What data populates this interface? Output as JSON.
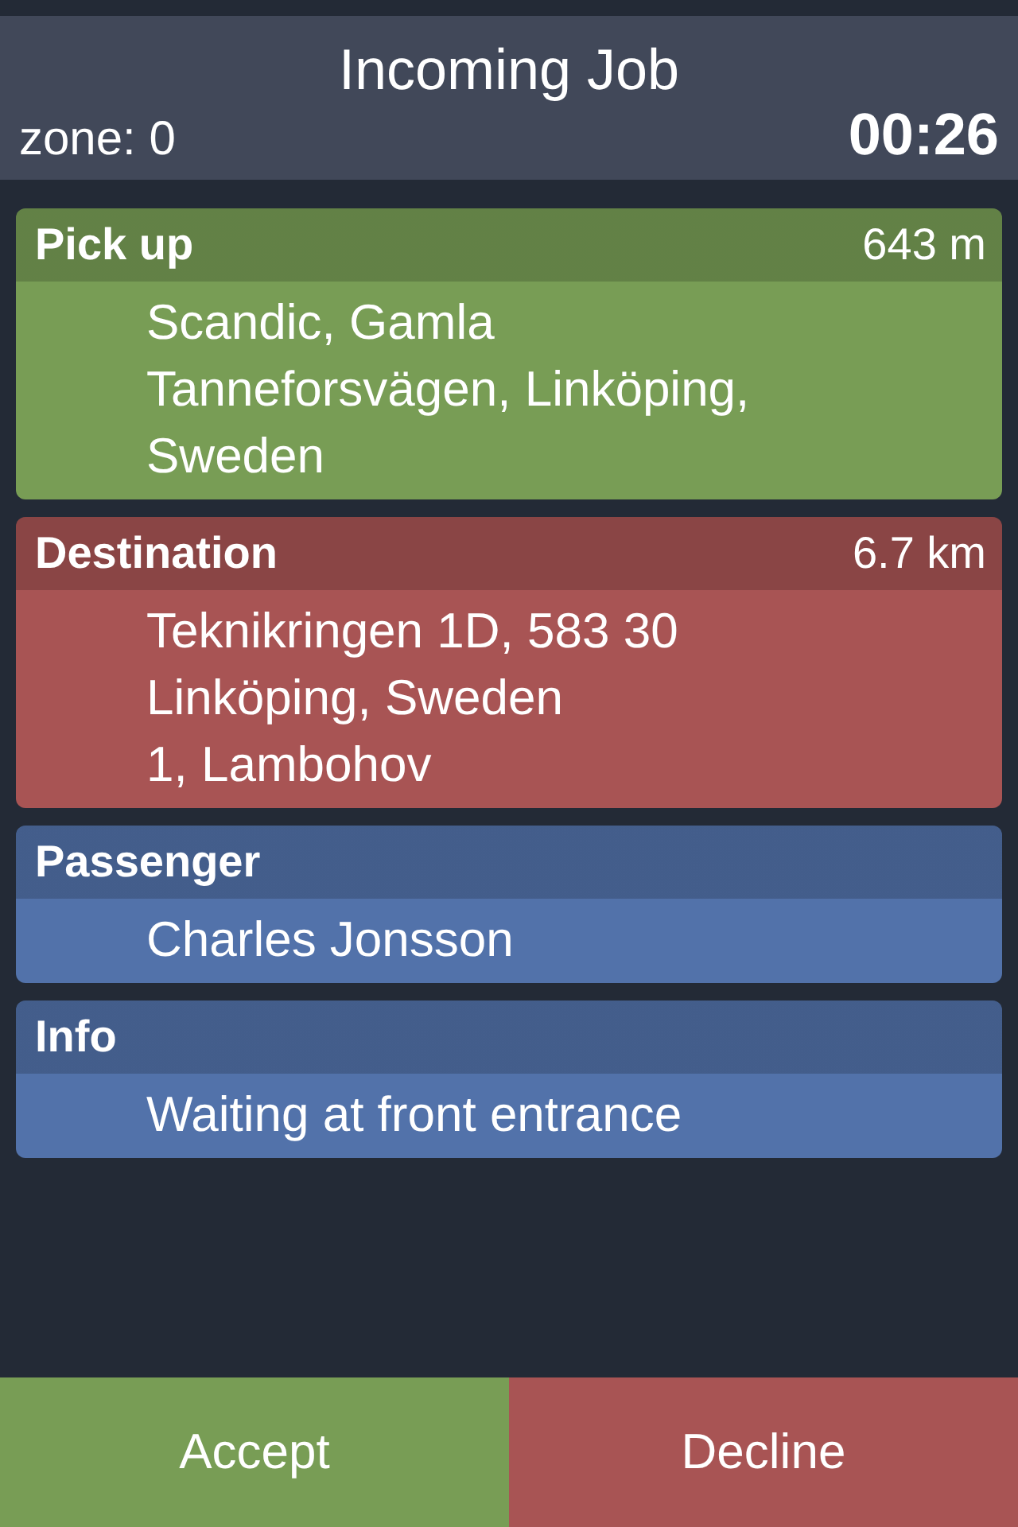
{
  "header": {
    "title": "Incoming Job",
    "zone": "zone: 0",
    "timer": "00:26"
  },
  "cards": [
    {
      "title": "Pick up",
      "distance": "643 m",
      "color": "#789d55",
      "lines": [
        "Scandic, Gamla",
        "Tanneforsvägen, Linköping,",
        "Sweden"
      ]
    },
    {
      "title": "Destination",
      "distance": "6.7 km",
      "color": "#a85454",
      "lines": [
        "Teknikringen 1D, 583 30",
        "Linköping, Sweden",
        "1, Lambohov"
      ]
    },
    {
      "title": "Passenger",
      "color": "#5272aa",
      "lines": [
        "Charles Jonsson"
      ]
    },
    {
      "title": "Info",
      "color": "#5272aa",
      "lines": [
        "Waiting at front entrance"
      ]
    }
  ],
  "actions": [
    {
      "label": "Accept",
      "color": "#789d55"
    },
    {
      "label": "Decline",
      "color": "#a85454"
    }
  ]
}
